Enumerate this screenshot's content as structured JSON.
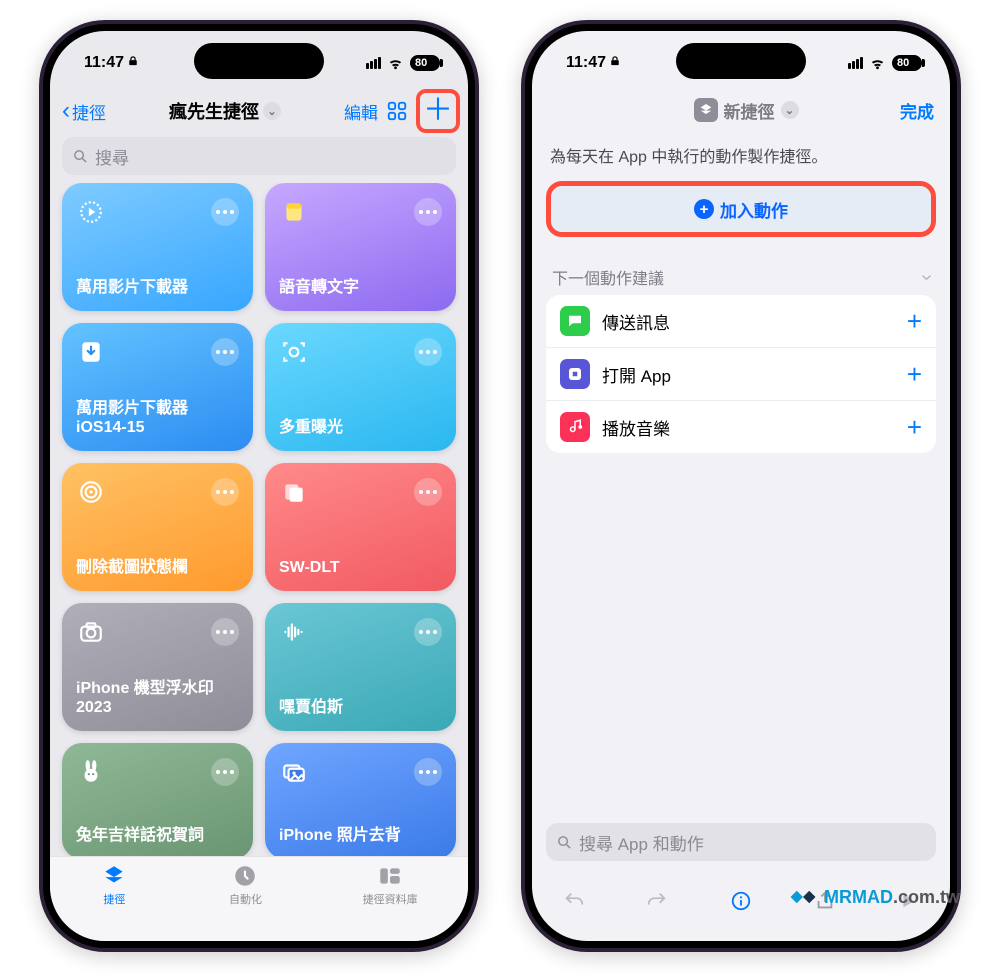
{
  "status": {
    "time": "11:47",
    "battery": "80"
  },
  "left": {
    "back": "捷徑",
    "title": "瘋先生捷徑",
    "edit": "編輯",
    "search_placeholder": "搜尋",
    "tiles": [
      {
        "label": "萬用影片下載器"
      },
      {
        "label": "語音轉文字"
      },
      {
        "label": "萬用影片下載器\niOS14-15"
      },
      {
        "label": "多重曝光"
      },
      {
        "label": "刪除截圖狀態欄"
      },
      {
        "label": "SW-DLT"
      },
      {
        "label": "iPhone 機型浮水印2023"
      },
      {
        "label": "嘿賈伯斯"
      },
      {
        "label": "兔年吉祥話祝賀詞"
      },
      {
        "label": "iPhone 照片去背"
      }
    ],
    "tabs": {
      "shortcuts": "捷徑",
      "automation": "自動化",
      "gallery": "捷徑資料庫"
    }
  },
  "right": {
    "title": "新捷徑",
    "done": "完成",
    "prompt": "為每天在 App 中執行的動作製作捷徑。",
    "add_action": "加入動作",
    "suggestions_header": "下一個動作建議",
    "suggestions": [
      {
        "label": "傳送訊息"
      },
      {
        "label": "打開 App"
      },
      {
        "label": "播放音樂"
      }
    ],
    "search_placeholder": "搜尋 App 和動作"
  },
  "watermark": {
    "brand": "MRMAD",
    "domain": ".com.tw"
  }
}
